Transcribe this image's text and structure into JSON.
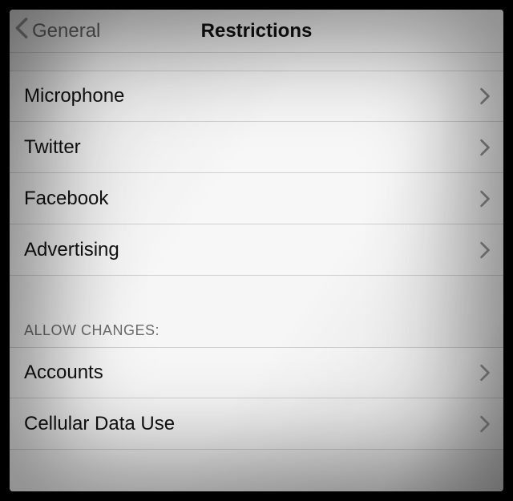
{
  "header": {
    "back_label": "General",
    "title": "Restrictions"
  },
  "group1": {
    "items": [
      {
        "label": "Microphone"
      },
      {
        "label": "Twitter"
      },
      {
        "label": "Facebook"
      },
      {
        "label": "Advertising"
      }
    ]
  },
  "group2": {
    "header": "ALLOW CHANGES:",
    "items": [
      {
        "label": "Accounts"
      },
      {
        "label": "Cellular Data Use"
      }
    ]
  }
}
